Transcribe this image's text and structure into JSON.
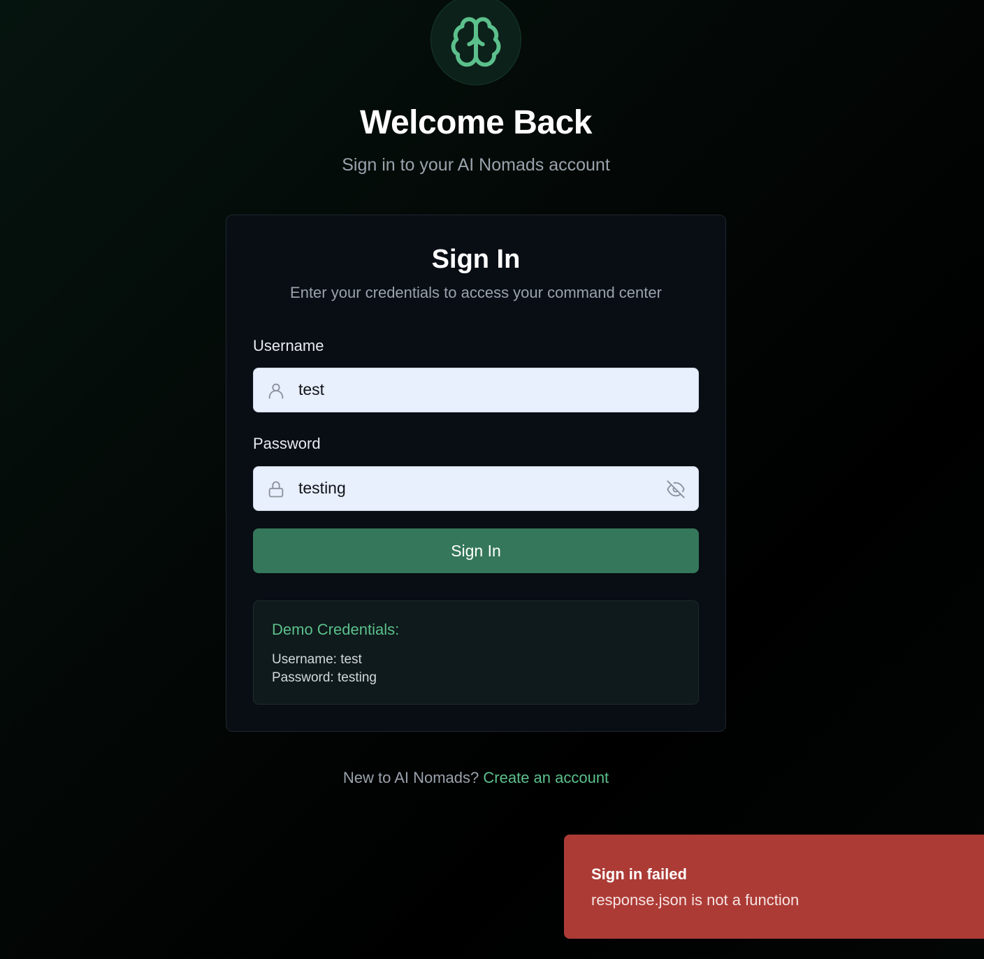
{
  "header": {
    "logo_icon": "brain-icon",
    "title": "Welcome Back",
    "subtitle": "Sign in to your AI Nomads account"
  },
  "card": {
    "title": "Sign In",
    "subtitle": "Enter your credentials to access your command center",
    "username": {
      "label": "Username",
      "value": "test",
      "icon": "user-icon"
    },
    "password": {
      "label": "Password",
      "value": "testing",
      "icon": "lock-icon",
      "toggle_icon": "eye-off-icon"
    },
    "submit_label": "Sign In",
    "demo": {
      "title": "Demo Credentials:",
      "username_line": "Username: test",
      "password_line": "Password: testing"
    }
  },
  "footer": {
    "prompt": "New to AI Nomads?",
    "link_label": "Create an account"
  },
  "toast": {
    "title": "Sign in failed",
    "message": "response.json is not a function"
  },
  "colors": {
    "accent": "#5cc08c",
    "button": "#35775a",
    "toast_bg": "#ac3b36",
    "card_bg": "#090d14"
  }
}
